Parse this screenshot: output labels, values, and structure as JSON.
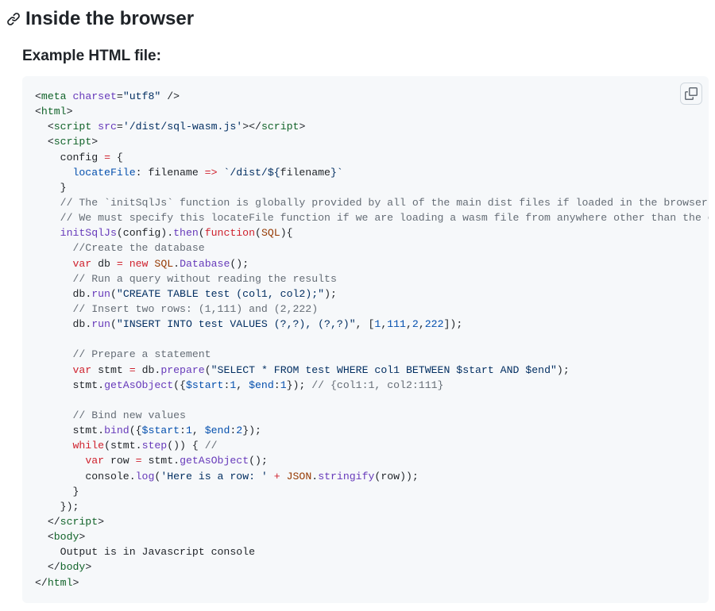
{
  "heading": "Inside the browser",
  "subheading": "Example HTML file:",
  "icons": {
    "link": "link-icon",
    "copy": "copy-icon"
  },
  "code": {
    "meta_open": "<",
    "meta_tag": "meta",
    "charset_attr": "charset",
    "charset_val": "\"utf8\"",
    "self_close": " />",
    "html_tag": "html",
    "open_gt": ">",
    "close_open": "</",
    "script_tag": "script",
    "src_attr": "src",
    "src_val": "'/dist/sql-wasm.js'",
    "body_tag": "body",
    "body_text": "    Output is in Javascript console",
    "cfg_line1": "    config ",
    "eq": "=",
    "brace_open": " {",
    "locateFile_key": "locateFile",
    "locateFile_rest": ": ",
    "filename_param": "filename",
    "arrow": " => ",
    "tmpl_open": "`/dist/",
    "tmpl_interp": "${",
    "tmpl_var": "filename",
    "tmpl_interp_close": "}",
    "tmpl_close": "`",
    "brace_close": "    }",
    "cmt_init1": "    // The `initSqlJs` function is globally provided by all of the main dist files if loaded in the browser.",
    "cmt_init2": "    // We must specify this locateFile function if we are loading a wasm file from anywhere other than the cur",
    "initSqlJs": "initSqlJs",
    "config_arg": "(config).",
    "then": "then",
    "paren_open": "(",
    "function_kw": "function",
    "SQL_param": "SQL",
    "fn_close_head": "){",
    "cmt_createdb": "      //Create the database",
    "var_kw": "var",
    "db_decl": " db ",
    "new_kw": "new",
    "SQL_ns": "SQL",
    "dot": ".",
    "Database_ctor": "Database",
    "empty_call": "();",
    "cmt_runquery": "      // Run a query without reading the results",
    "db_ident": "db",
    "run_method": "run",
    "create_sql": "\"CREATE TABLE test (col1, col2);\"",
    "call_close": ");",
    "cmt_insert": "      // Insert two rows: (1,111) and (2,222)",
    "insert_sql": "\"INSERT INTO test VALUES (?,?), (?,?)\"",
    "comma_sp": ", ",
    "arr_open": "[",
    "n1": "1",
    "comma": ",",
    "n111": "111",
    "n2": "2",
    "n222": "222",
    "arr_close_call": "]);",
    "cmt_prepare": "      // Prepare a statement",
    "stmt_decl": " stmt ",
    "prepare_method": "prepare",
    "select_sql": "\"SELECT * FROM test WHERE col1 BETWEEN $start AND $end\"",
    "stmt_ident": "stmt",
    "getAsObject_method": "getAsObject",
    "obj_open": "({",
    "start_key": "$start",
    "colon": ":",
    "end_key": "$end",
    "obj_close_call": "});",
    "cmt_result": " // {col1:1, col2:111}",
    "cmt_bind": "      // Bind new values",
    "bind_method": "bind",
    "while_kw": "while",
    "step_method": "step",
    "while_head_close": "()) { ",
    "cmt_slashslash": "//",
    "row_decl": " row ",
    "console_ident": "console",
    "log_method": "log",
    "row_str": "'Here is a row: '",
    "plus": " + ",
    "JSON_ident": "JSON",
    "stringify_method": "stringify",
    "row_ident": "row",
    "inner_call_close": "));",
    "inner_brace_close": "      }",
    "then_close": "    });"
  }
}
